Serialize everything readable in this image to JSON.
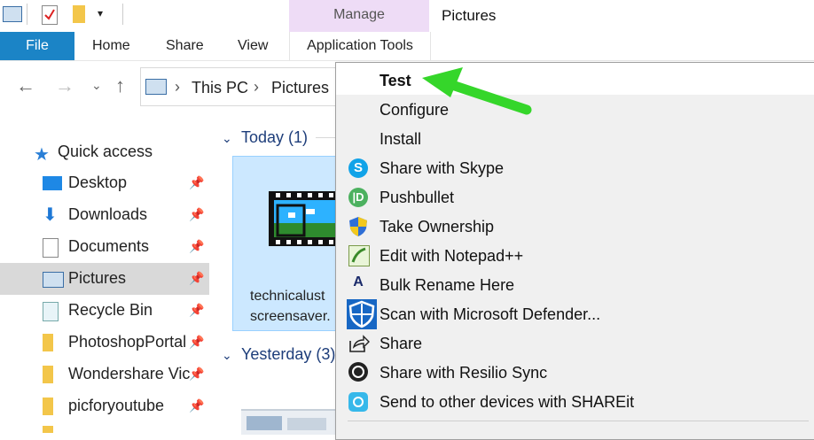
{
  "window": {
    "title": "Pictures"
  },
  "ribbon": {
    "context_tab_group": "Manage",
    "tabs": [
      "File",
      "Home",
      "Share",
      "View",
      "Application Tools"
    ]
  },
  "address": {
    "breadcrumb": [
      "This PC",
      "Pictures"
    ]
  },
  "sidebar": {
    "quick_access": "Quick access",
    "items": [
      {
        "label": "Desktop",
        "pinned": true
      },
      {
        "label": "Downloads",
        "pinned": true
      },
      {
        "label": "Documents",
        "pinned": true
      },
      {
        "label": "Pictures",
        "pinned": true,
        "selected": true
      },
      {
        "label": "Recycle Bin",
        "pinned": true
      },
      {
        "label": "PhotoshopPortal",
        "pinned": true
      },
      {
        "label": "Wondershare Vic",
        "pinned": true
      },
      {
        "label": "picforyoutube",
        "pinned": true
      }
    ]
  },
  "content": {
    "groups": [
      {
        "label": "Today (1)"
      },
      {
        "label": "Yesterday (3)"
      }
    ],
    "file": {
      "name_line1": "technicalust",
      "name_line2": "screensaver."
    }
  },
  "context_menu": {
    "items": [
      {
        "label": "Test",
        "icon": "none",
        "bold": true
      },
      {
        "label": "Configure",
        "icon": "none"
      },
      {
        "label": "Install",
        "icon": "none"
      },
      {
        "label": "Share with Skype",
        "icon": "skype-icon"
      },
      {
        "label": "Pushbullet",
        "icon": "pushbullet-icon"
      },
      {
        "label": "Take Ownership",
        "icon": "shield-uac-icon"
      },
      {
        "label": "Edit with Notepad++",
        "icon": "notepadpp-icon"
      },
      {
        "label": "Bulk Rename Here",
        "icon": "bulk-rename-icon"
      },
      {
        "label": "Scan with Microsoft Defender...",
        "icon": "defender-icon"
      },
      {
        "label": "Share",
        "icon": "share-icon"
      },
      {
        "label": "Share with Resilio Sync",
        "icon": "resilio-icon"
      },
      {
        "label": "Send to other devices with SHAREit",
        "icon": "shareit-icon"
      }
    ]
  },
  "colors": {
    "file_tab": "#1b84c6",
    "manage_tab": "#eedcf6",
    "arrow": "#35d62a",
    "selection": "#cce8ff"
  }
}
